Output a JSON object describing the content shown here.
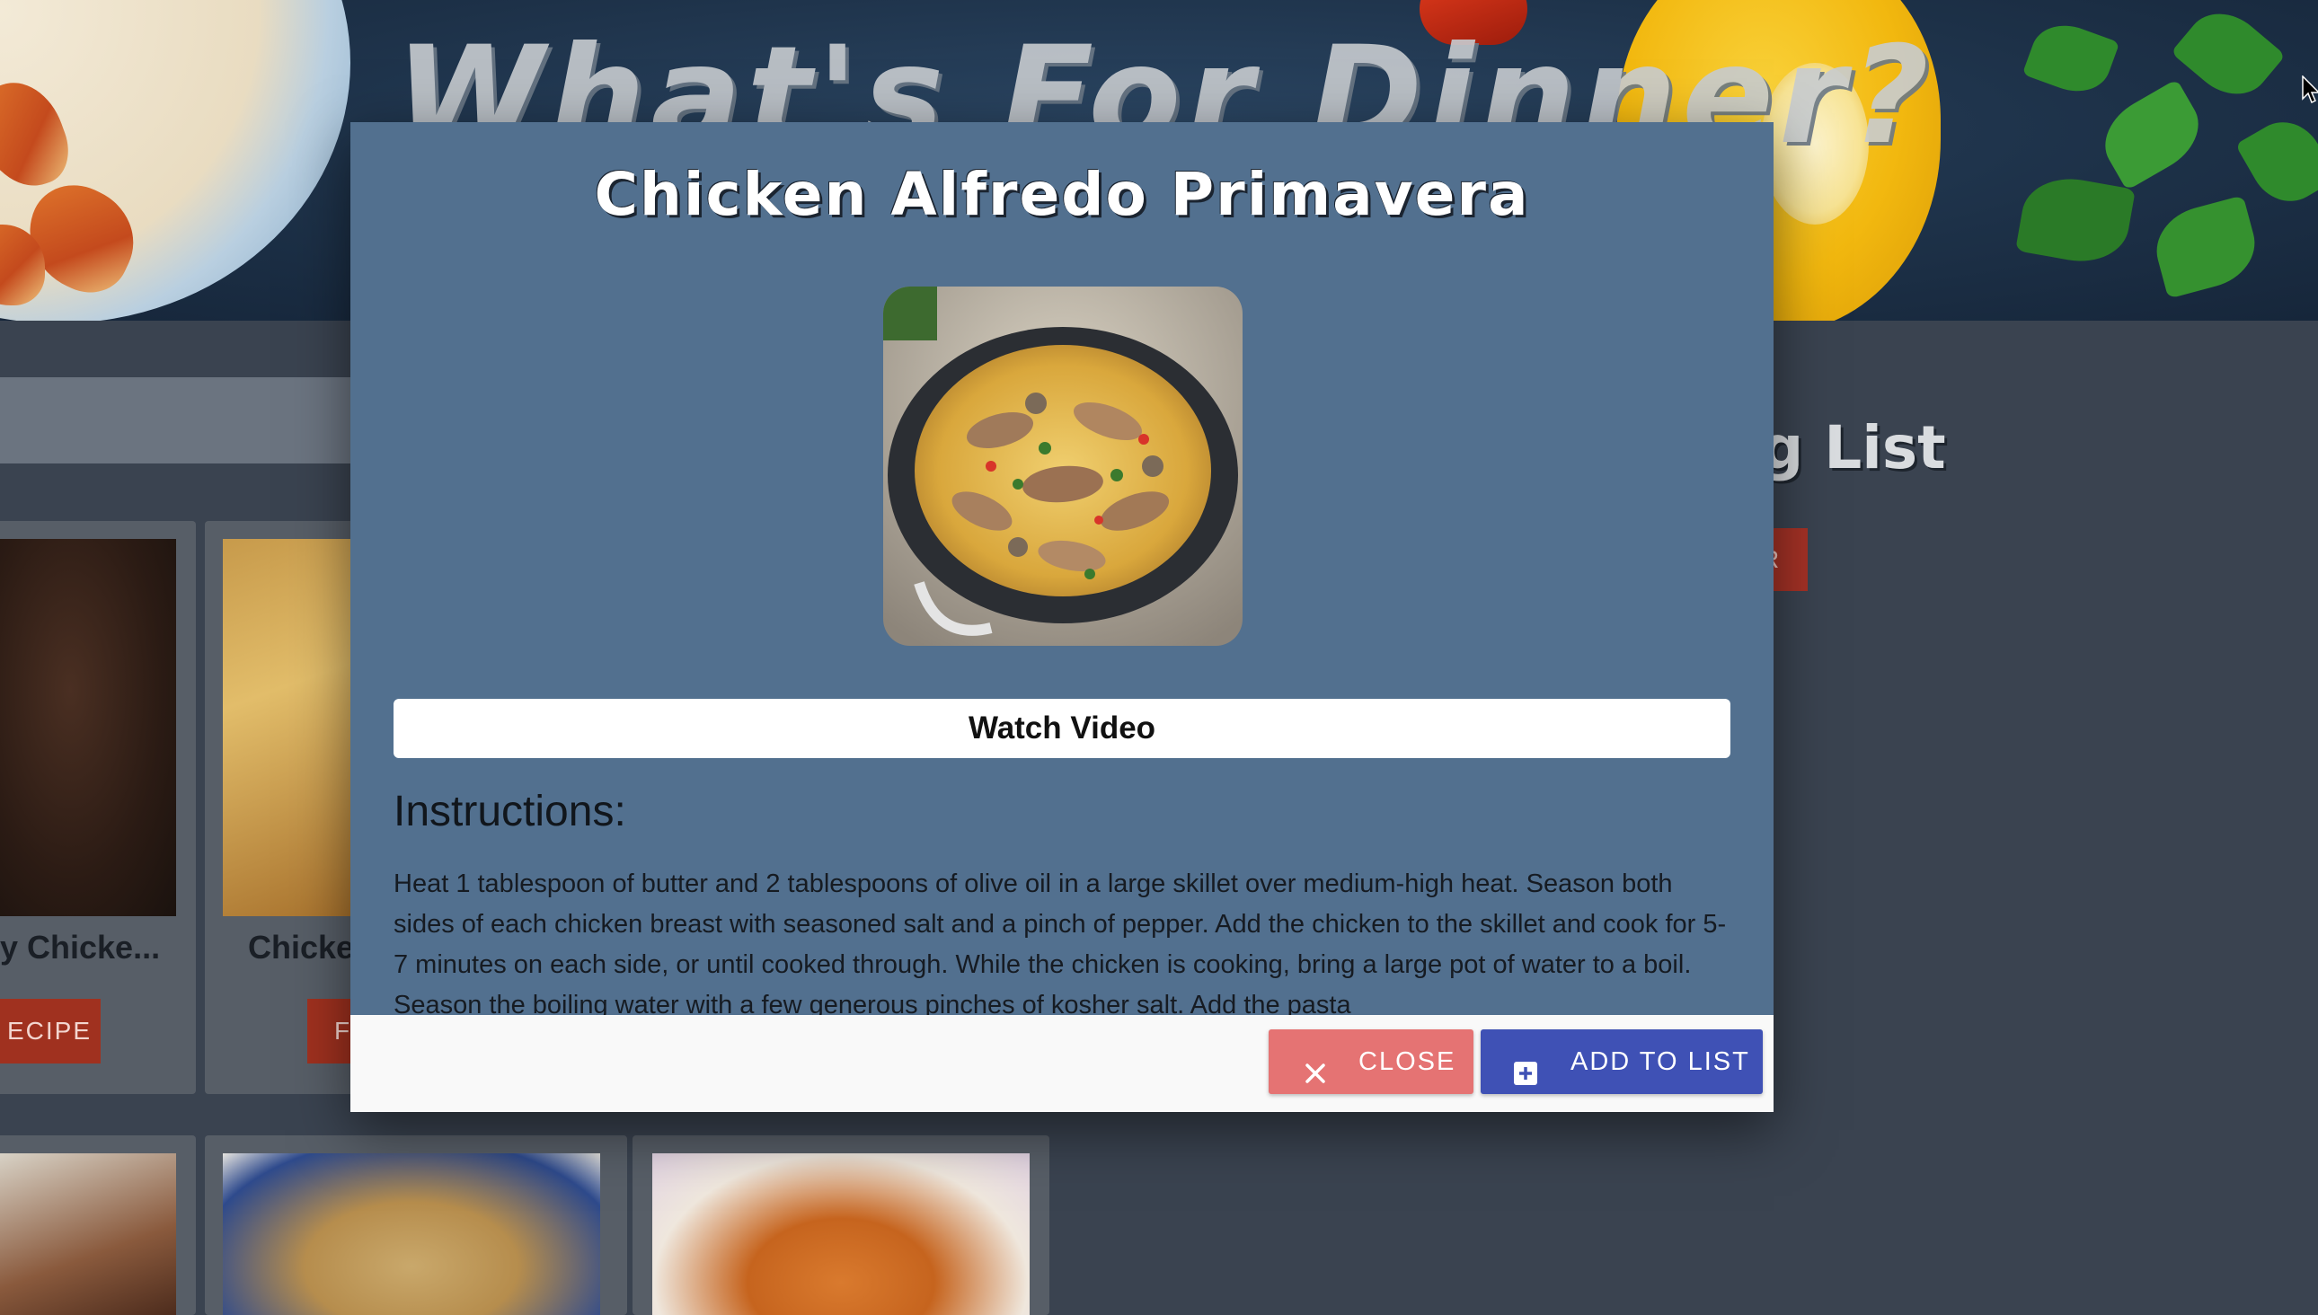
{
  "page": {
    "hero_title": "What's For Dinner?",
    "shopping_list_title": "g List",
    "shopping_list_button": "R"
  },
  "recipe_cards": [
    {
      "title": "y Chicke...",
      "button": "ECIPE"
    },
    {
      "title": "Chicke",
      "button": "F"
    }
  ],
  "modal": {
    "title": "Chicken Alfredo Primavera",
    "watch_video_label": "Watch Video",
    "instructions_heading": "Instructions:",
    "instructions_text": "Heat 1 tablespoon of butter and 2 tablespoons of olive oil in a large skillet over medium-high heat. Season both sides of each chicken breast with seasoned salt and a pinch of pepper. Add the chicken to the skillet and cook for 5-7 minutes on each side, or until cooked through. While the chicken is cooking, bring a large pot of water to a boil. Season the boiling water with a few generous pinches of kosher salt. Add the pasta",
    "close_label": "CLOSE",
    "add_to_list_label": "ADD TO LIST",
    "close_icon": "close-icon",
    "add_icon": "add-box-icon"
  },
  "colors": {
    "modal_background": "#52708f",
    "close_button": "#e57373",
    "add_button": "#3f51b5",
    "card_button": "#a0311f"
  }
}
